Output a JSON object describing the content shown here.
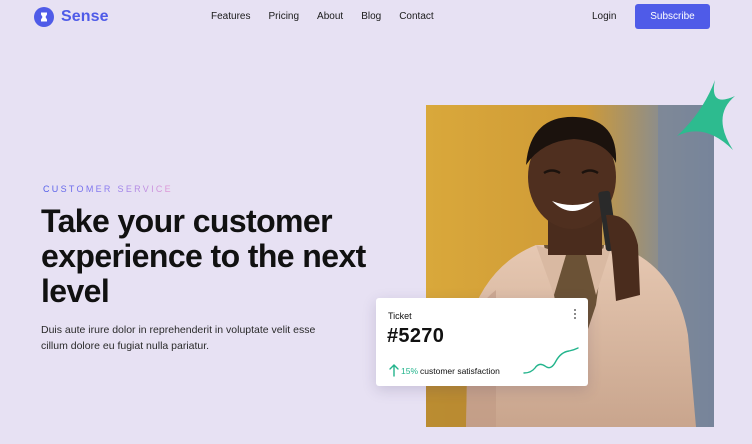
{
  "brand": {
    "name": "Sense",
    "color": "#4f5be8"
  },
  "nav": {
    "links": [
      "Features",
      "Pricing",
      "About",
      "Blog",
      "Contact"
    ],
    "login_label": "Login",
    "subscribe_label": "Subscribe"
  },
  "hero": {
    "eyebrow": "CUSTOMER SERVICE",
    "headline": "Take your customer experience to the next level",
    "subtext": "Duis aute irure dolor in reprehenderit in voluptate velit esse cillum dolore eu fugiat nulla pariatur."
  },
  "ticket_card": {
    "label": "Ticket",
    "number": "#5270",
    "percent": "15%",
    "metric_label": "customer satisfaction",
    "accent_color": "#23b48c"
  },
  "colors": {
    "background": "#e7e1f3",
    "accent": "#4f5be8",
    "star": "#2dbb8f"
  },
  "icons": [
    "sense-logo-icon",
    "more-vertical-icon",
    "arrow-up-icon",
    "sparkline-icon",
    "sparkle-star-icon"
  ]
}
